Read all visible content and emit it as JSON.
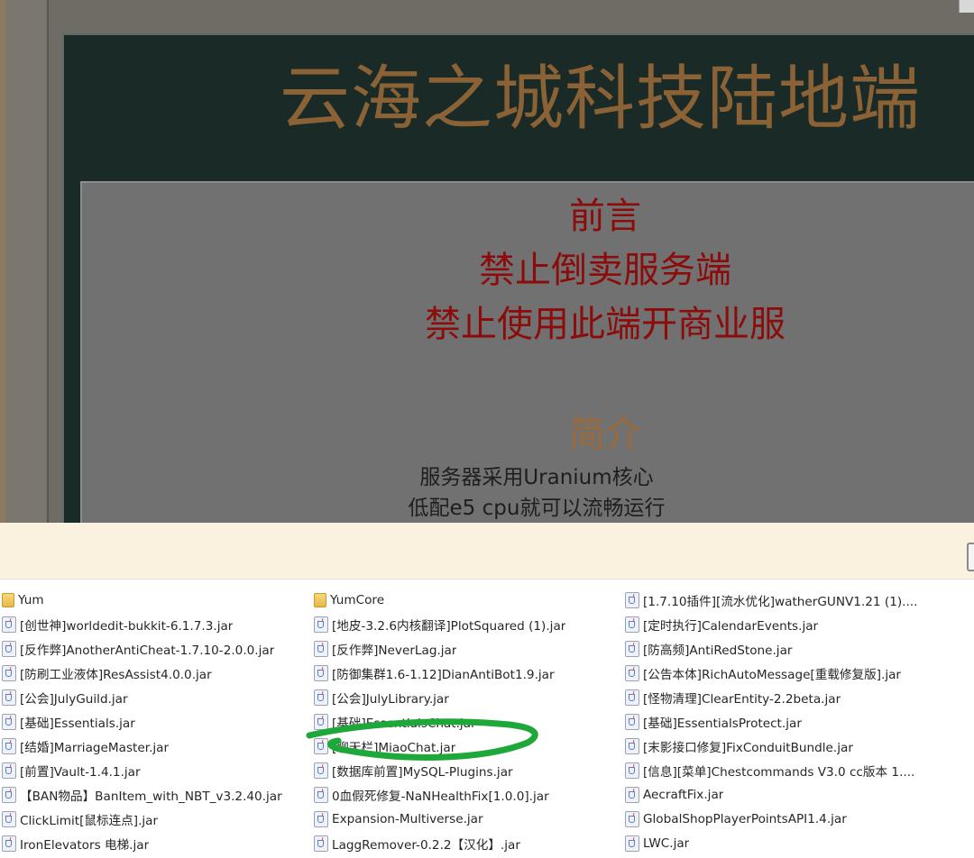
{
  "post": {
    "title": "云海之城科技陆地端",
    "preface_heading": "前言",
    "preface_lines": [
      "禁止倒卖服务端",
      "禁止使用此端开商业服"
    ],
    "intro_heading": "简介",
    "intro_lines": [
      "服务器采用Uranium核心",
      "低配e5 cpu就可以流畅运行"
    ]
  },
  "colors": {
    "title": "#8b6236",
    "warning_text": "#8c0c0c",
    "intro_heading": "#9a6a3a",
    "explorer_header": "#faf2de",
    "annotation_scribble": "#1fa83a"
  },
  "explorer": {
    "columns": [
      [
        {
          "name": "Yum",
          "icon": "folder-icon"
        },
        {
          "name": "[创世神]worldedit-bukkit-6.1.7.3.jar",
          "icon": "jar-icon"
        },
        {
          "name": "[反作弊]AnotherAntiCheat-1.7.10-2.0.0.jar",
          "icon": "jar-icon"
        },
        {
          "name": "[防刷工业液体]ResAssist4.0.0.jar",
          "icon": "jar-icon"
        },
        {
          "name": "[公会]JulyGuild.jar",
          "icon": "jar-icon"
        },
        {
          "name": "[基础]Essentials.jar",
          "icon": "jar-icon"
        },
        {
          "name": "[结婚]MarriageMaster.jar",
          "icon": "jar-icon"
        },
        {
          "name": "[前置]Vault-1.4.1.jar",
          "icon": "jar-icon"
        },
        {
          "name": "【BAN物品】BanItem_with_NBT_v3.2.40.jar",
          "icon": "jar-icon"
        },
        {
          "name": "ClickLimit[鼠标连点].jar",
          "icon": "jar-icon"
        },
        {
          "name": "IronElevators 电梯.jar",
          "icon": "jar-icon"
        }
      ],
      [
        {
          "name": "YumCore",
          "icon": "folder-icon"
        },
        {
          "name": "[地皮-3.2.6内核翻译]PlotSquared (1).jar",
          "icon": "jar-icon"
        },
        {
          "name": "[反作弊]NeverLag.jar",
          "icon": "jar-icon"
        },
        {
          "name": "[防御集群1.6-1.12]DianAntiBot1.9.jar",
          "icon": "jar-icon"
        },
        {
          "name": "[公会]JulyLibrary.jar",
          "icon": "jar-icon"
        },
        {
          "name": "[基础]EssentialsChat.jar",
          "icon": "jar-icon"
        },
        {
          "name": "[聊天栏]MiaoChat.jar",
          "icon": "jar-icon"
        },
        {
          "name": "[数据库前置]MySQL-Plugins.jar",
          "icon": "jar-icon"
        },
        {
          "name": "0血假死修复-NaNHealthFix[1.0.0].jar",
          "icon": "jar-icon"
        },
        {
          "name": "Expansion-Multiverse.jar",
          "icon": "jar-icon"
        },
        {
          "name": "LaggRemover-0.2.2【汉化】.jar",
          "icon": "jar-icon"
        }
      ],
      [
        {
          "name": "[1.7.10插件][流水优化]watherGUNV1.21 (1)....",
          "icon": "jar-icon"
        },
        {
          "name": "[定时执行]CalendarEvents.jar",
          "icon": "jar-icon"
        },
        {
          "name": "[防高频]AntiRedStone.jar",
          "icon": "jar-icon"
        },
        {
          "name": "[公告本体]RichAutoMessage[重载修复版].jar",
          "icon": "jar-icon"
        },
        {
          "name": "[怪物清理]ClearEntity-2.2beta.jar",
          "icon": "jar-icon"
        },
        {
          "name": "[基础]EssentialsProtect.jar",
          "icon": "jar-icon"
        },
        {
          "name": "[末影接口修复]FixConduitBundle.jar",
          "icon": "jar-icon"
        },
        {
          "name": "[信息][菜单]Chestcommands V3.0 cc版本 1....",
          "icon": "jar-icon"
        },
        {
          "name": "AecraftFix.jar",
          "icon": "jar-icon"
        },
        {
          "name": "GlobalShopPlayerPointsAPI1.4.jar",
          "icon": "jar-icon"
        },
        {
          "name": "LWC.jar",
          "icon": "jar-icon"
        }
      ]
    ]
  }
}
